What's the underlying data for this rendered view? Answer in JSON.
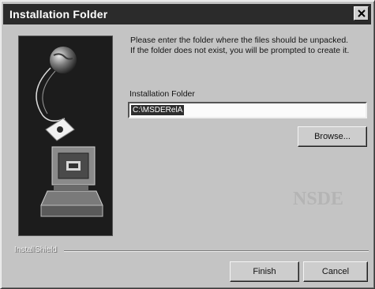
{
  "dialog": {
    "title": "Installation Folder",
    "instruction_line1": "Please enter the folder where the files should be unpacked.",
    "instruction_line2": "If the folder does not exist, you will be prompted to create it.",
    "field_label": "Installation Folder",
    "field_value": "C:\\MSDERelA",
    "browse_label": "Browse...",
    "finish_label": "Finish",
    "cancel_label": "Cancel",
    "footer_brand": "InstallShield"
  },
  "icons": {
    "close": "close-icon",
    "art": "setup-computer-illustration"
  }
}
